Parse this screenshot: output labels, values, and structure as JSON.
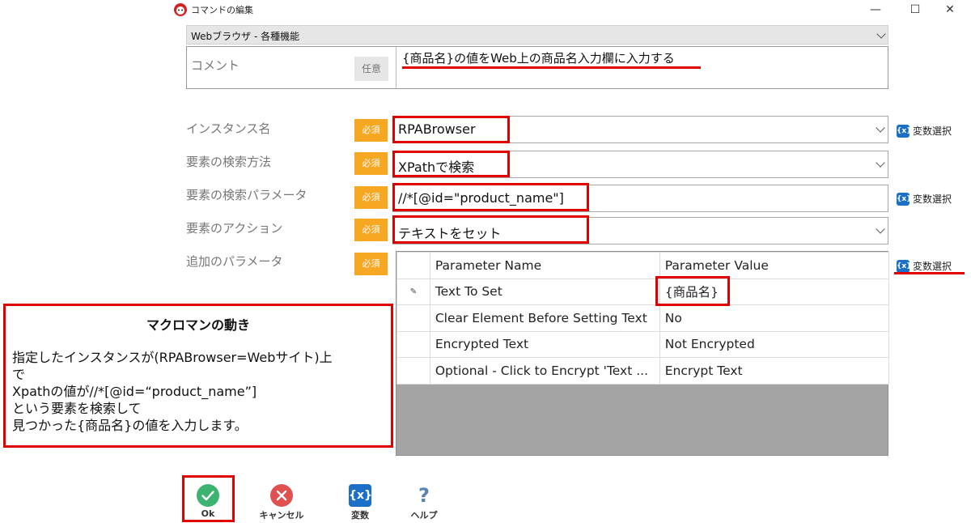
{
  "window": {
    "title": "コマンドの編集",
    "minimize_glyph": "—",
    "maximize_glyph": "☐",
    "close_glyph": "✕"
  },
  "category": {
    "value": "Webブラウザ - 各種機能"
  },
  "comment": {
    "label": "コメント",
    "badge": "任意",
    "value": "{商品名}の値をWeb上の商品名入力欄に入力する"
  },
  "required_badge": "必須",
  "fields": [
    {
      "label": "インスタンス名",
      "value": "RPABrowser",
      "has_var_select": true
    },
    {
      "label": "要素の検索方法",
      "value": "XPathで検索"
    },
    {
      "label": "要素の検索パラメータ",
      "value": "//*[@id=\"product_name\"]",
      "has_var_select": true
    },
    {
      "label": "要素のアクション",
      "value": "テキストをセット"
    },
    {
      "label": "追加のパラメータ",
      "has_var_select": true
    }
  ],
  "var_select": {
    "icon": "{x}",
    "label": "変数選択"
  },
  "params": {
    "headers": [
      "Parameter Name",
      "Parameter Value"
    ],
    "edit_glyph": "✎",
    "rows": [
      {
        "name": "Text To Set",
        "value": "{商品名}"
      },
      {
        "name": "Clear Element Before Setting Text",
        "value": "No"
      },
      {
        "name": "Encrypted Text",
        "value": "Not Encrypted"
      },
      {
        "name": "Optional - Click to Encrypt 'Text ...",
        "value": "Encrypt Text"
      }
    ]
  },
  "callout": {
    "title": "マクロマンの動き",
    "lines": [
      "指定したインスタンスが(RPABrowser=Webサイト)上",
      "で",
      "Xpathの値が//*[@id=“product_name”]",
      "という要素を検索して",
      "見つかった{商品名}の値を入力します。"
    ]
  },
  "toolbar": {
    "ok": "Ok",
    "cancel": "キャンセル",
    "variables": "変数",
    "variables_icon": "{x}",
    "help": "ヘルプ",
    "help_icon": "?"
  },
  "colors": {
    "required": "#f7a823",
    "highlight": "#e00000",
    "ok": "#3cb371",
    "cancel": "#e05050",
    "variables": "#1b6fc7",
    "help": "#5a82b4"
  }
}
